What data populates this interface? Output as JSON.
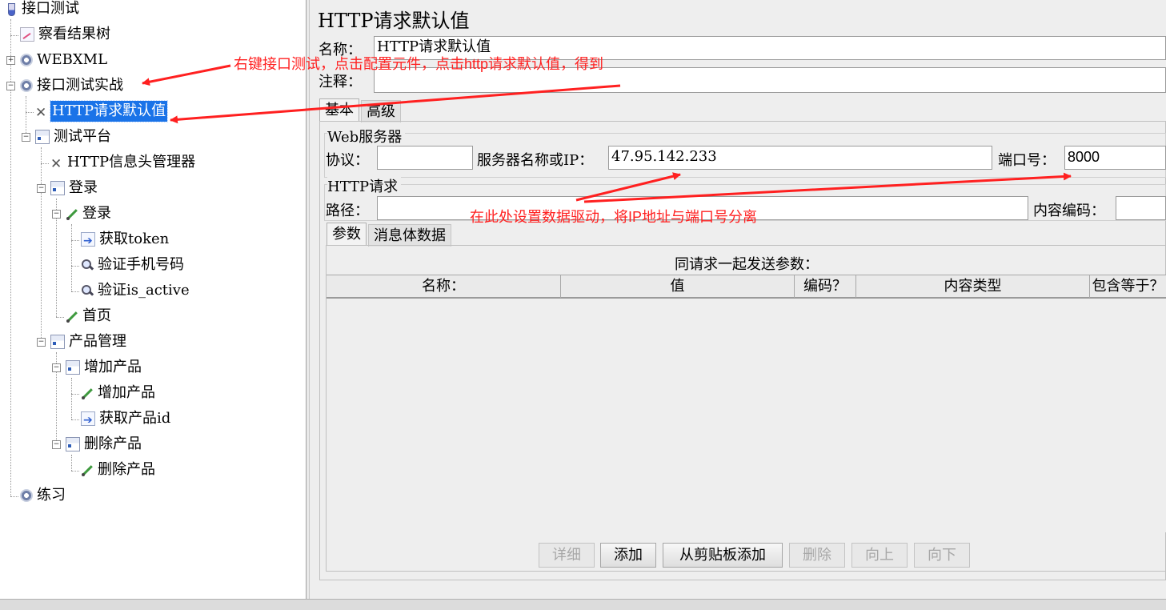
{
  "tree": {
    "items": [
      {
        "label": "接口测试",
        "icon": "flask-icon"
      },
      {
        "label": "察看结果树",
        "icon": "chart-icon"
      },
      {
        "label": "WEBXML",
        "icon": "gear-icon"
      },
      {
        "label": "接口测试实战",
        "icon": "gear-icon"
      },
      {
        "label": "HTTP请求默认值",
        "icon": "tool-icon",
        "selected": true
      },
      {
        "label": "测试平台",
        "icon": "thread-group-icon"
      },
      {
        "label": "HTTP信息头管理器",
        "icon": "tool-icon"
      },
      {
        "label": "登录",
        "icon": "thread-group-icon"
      },
      {
        "label": "登录",
        "icon": "pipette-icon"
      },
      {
        "label": "获取token",
        "icon": "post-processor-icon"
      },
      {
        "label": "验证手机号码",
        "icon": "magnifier-icon"
      },
      {
        "label": "验证is_active",
        "icon": "magnifier-icon"
      },
      {
        "label": "首页",
        "icon": "pipette-icon"
      },
      {
        "label": "产品管理",
        "icon": "thread-group-icon"
      },
      {
        "label": "增加产品",
        "icon": "thread-group-icon"
      },
      {
        "label": "增加产品",
        "icon": "pipette-icon"
      },
      {
        "label": "获取产品id",
        "icon": "post-processor-icon"
      },
      {
        "label": "删除产品",
        "icon": "thread-group-icon"
      },
      {
        "label": "删除产品",
        "icon": "pipette-icon"
      },
      {
        "label": "练习",
        "icon": "gear-icon"
      }
    ]
  },
  "panel": {
    "title": "HTTP请求默认值",
    "name_label": "名称：",
    "name_value": "HTTP请求默认值",
    "comment_label": "注释：",
    "comment_value": "",
    "tabs": [
      "基本",
      "高级"
    ],
    "web_server": {
      "title": "Web服务器",
      "protocol_label": "协议：",
      "protocol_value": "",
      "server_label": "服务器名称或IP：",
      "server_value": "47.95.142.233",
      "port_label": "端口号：",
      "port_value": "8000"
    },
    "http_request": {
      "title": "HTTP请求",
      "path_label": "路径：",
      "path_value": "",
      "encoding_label": "内容编码：",
      "encoding_value": ""
    },
    "sub_tabs": [
      "参数",
      "消息体数据"
    ],
    "params_caption": "同请求一起发送参数：",
    "columns": [
      "名称：",
      "值",
      "编码？",
      "内容类型",
      "包含等于？"
    ],
    "buttons": [
      {
        "label": "详细",
        "enabled": false
      },
      {
        "label": "添加",
        "enabled": true
      },
      {
        "label": "从剪贴板添加",
        "enabled": true
      },
      {
        "label": "删除",
        "enabled": false
      },
      {
        "label": "向上",
        "enabled": false
      },
      {
        "label": "向下",
        "enabled": false
      }
    ]
  },
  "annotations": {
    "note1": "右键接口测试，点击配置元件，点击http请求默认值，得到",
    "note2": "在此处设置数据驱动，将IP地址与端口号分离",
    "color": "#ff2020"
  },
  "colors": {
    "selection": "#1a73e8",
    "panel_bg": "#eeeeee"
  }
}
